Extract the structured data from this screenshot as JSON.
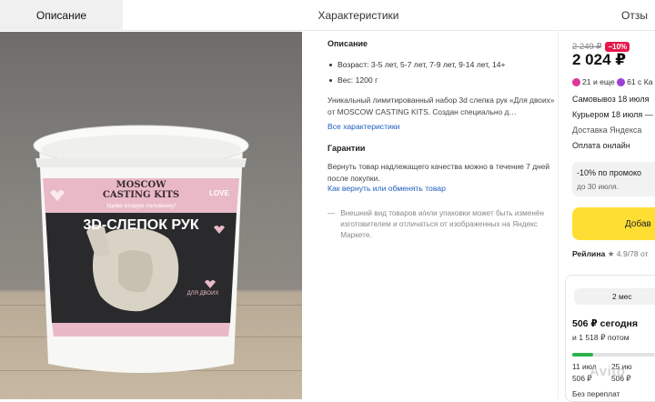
{
  "tabs": [
    {
      "label": "Описание",
      "active": true
    },
    {
      "label": "Характеристики",
      "active": false
    },
    {
      "label": "Отзы",
      "active": false
    }
  ],
  "product_image": {
    "brand_line1": "MOSCOW",
    "brand_line2": "CASTING KITS",
    "tagline": "Удиви вторую половинку!",
    "title": "3D-СЛЕПОК РУК",
    "sub": "ДЛЯ ДВОИХ",
    "love": "LOVE"
  },
  "description": {
    "heading": "Описание",
    "bullets": [
      "Возраст: 3-5 лет, 5-7 лет, 7-9 лет, 9-14 лет, 14+",
      "Вес: 1200 г"
    ],
    "text": "Уникальный лимитированный набор 3d слепка рук «Для двоих» от MOSCOW CASTING KITS. Создан специально д…",
    "all_specs_link": "Все характеристики",
    "guarantee_heading": "Гарантии",
    "guarantee_text": "Вернуть товар надлежащего качества можно в течение 7 дней после покупки.",
    "return_link": "Как вернуть или обменять товар",
    "disclaimer_dash": "—",
    "disclaimer": "Внешний вид товаров и/или упаковки может быть изменён изготовителем и отличаться от изображенных на Яндекс Маркете."
  },
  "pricing": {
    "old_price": "2 249 ₽",
    "discount": "−10%",
    "price": "2 024 ₽",
    "points_a": "21",
    "points_sep": "и еще",
    "points_b": "61",
    "points_suffix": "с Ка",
    "pickup": "Самовывоз 18 июля",
    "courier": "Курьером 18 июля —",
    "delivery": "Доставка Яндекса",
    "online_pay": "Оплата онлайн",
    "promo_title": "-10% по промоко",
    "promo_until": "до 30 июля.",
    "add_button": "Добав",
    "rating_label": "Рейлина",
    "rating_value": "★ 4.9/78 от",
    "split_period": "2 мес",
    "pay_today": "506 ₽ сегодня",
    "pay_later": "и 1 518 ₽ потом",
    "progress": 0.25,
    "date1": "11 июл",
    "date2": "25 ию",
    "amount1": "506 ₽",
    "amount2": "506 ₽",
    "no_overpay": "Без переплат",
    "watermark": "Avito"
  },
  "colors": {
    "accent_yellow": "#fede33",
    "discount_red": "#e6194b",
    "link_blue": "#2060c0",
    "points_pink": "#e0389a",
    "points_purple": "#9b3fd6",
    "progress_green": "#2bb24c"
  }
}
